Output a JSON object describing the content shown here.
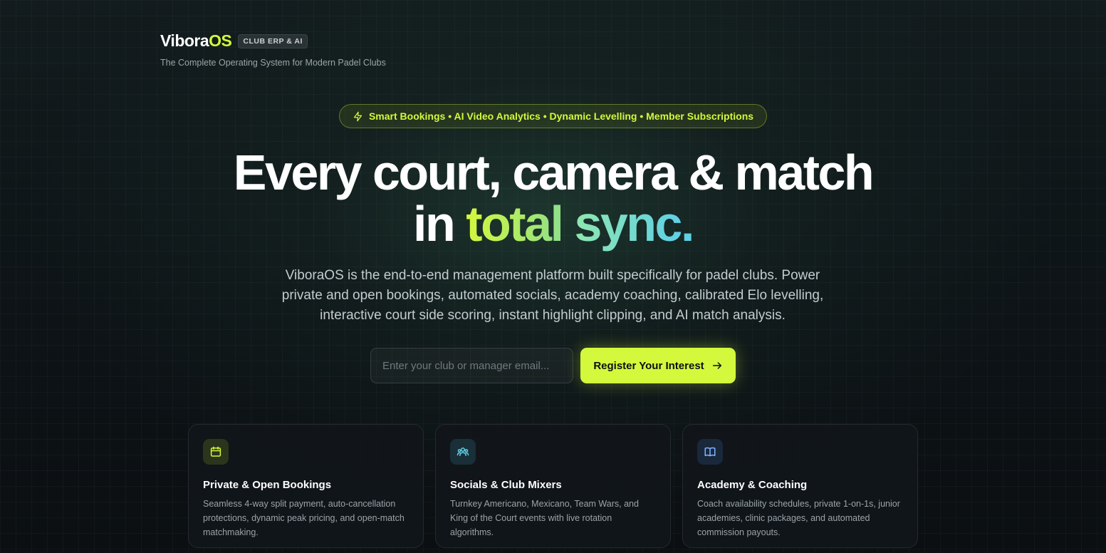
{
  "brand": {
    "logo_main": "Vibora",
    "logo_accent": "OS",
    "badge": "CLUB ERP & AI",
    "tagline": "The Complete Operating System for Modern Padel Clubs"
  },
  "hero": {
    "pill": "Smart Bookings • AI Video Analytics • Dynamic Levelling • Member Subscriptions",
    "pill_icon": "lightning-icon",
    "headline_line1": "Every court, camera & match",
    "headline_line2_prefix": "in",
    "headline_word1": "total",
    "headline_word2": "sync",
    "headline_dot": ".",
    "description": "ViboraOS is the end-to-end management platform built specifically for padel clubs. Power private and open bookings, automated socials, academy coaching, calibrated Elo levelling, interactive court side scoring, instant highlight clipping, and AI match analysis."
  },
  "signup": {
    "email_placeholder": "Enter your club or manager email...",
    "email_value": "",
    "cta_label": "Register Your Interest",
    "cta_icon": "arrow-right-icon"
  },
  "features": [
    {
      "icon": "calendar-icon",
      "title": "Private & Open Bookings",
      "body": "Seamless 4-way split payment, auto-cancellation protections, dynamic peak pricing, and open-match matchmaking."
    },
    {
      "icon": "users-icon",
      "title": "Socials & Club Mixers",
      "body": "Turnkey Americano, Mexicano, Team Wars, and King of the Court events with live rotation algorithms."
    },
    {
      "icon": "book-icon",
      "title": "Academy & Coaching",
      "body": "Coach availability schedules, private 1-on-1s, junior academies, clinic packages, and automated commission payouts."
    }
  ],
  "colors": {
    "accent": "#d4f83c",
    "cyan": "#5fd0e6",
    "background": "#0b0f12"
  }
}
